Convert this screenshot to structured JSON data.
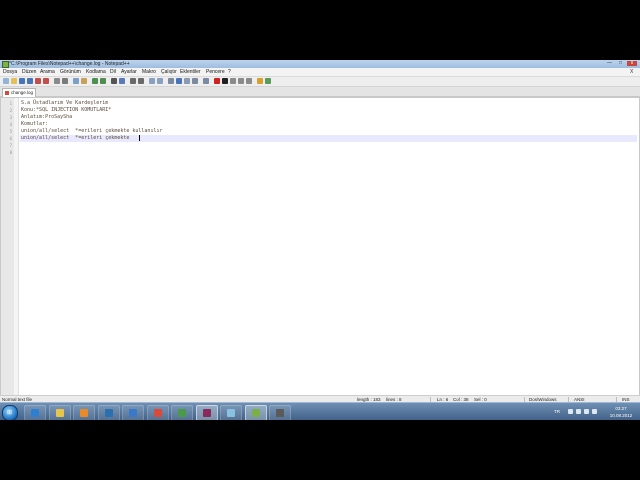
{
  "window": {
    "title": "*C:\\Program Files\\Notepad++\\change.log - Notepad++",
    "minimize_glyph": "—",
    "maximize_glyph": "□",
    "close_glyph": "x"
  },
  "menu": {
    "items": [
      "Dosya",
      "Düzen",
      "Arama",
      "Görünüm",
      "Kodlama",
      "Dil",
      "Ayarlar",
      "Makro",
      "Çalıştır",
      "Eklentiler",
      "Pencere",
      "?"
    ],
    "close_glyph": "X"
  },
  "toolbar": {
    "buttons": [
      {
        "icon": "new-file-icon",
        "color": "#8fb4d8"
      },
      {
        "icon": "open-file-icon",
        "color": "#e3c05a"
      },
      {
        "icon": "save-icon",
        "color": "#4a74b8"
      },
      {
        "icon": "save-all-icon",
        "color": "#4a74b8"
      },
      {
        "icon": "close-icon",
        "color": "#c0504d"
      },
      {
        "icon": "close-all-icon",
        "color": "#c0504d"
      },
      {
        "icon": "print-icon",
        "color": "#8a8a8a"
      },
      {
        "icon": "cut-icon",
        "color": "#7a7a7a"
      },
      {
        "icon": "copy-icon",
        "color": "#7aa0c8"
      },
      {
        "icon": "paste-icon",
        "color": "#c9a05a"
      },
      {
        "icon": "undo-icon",
        "color": "#4f8f4f"
      },
      {
        "icon": "redo-icon",
        "color": "#4f8f4f"
      },
      {
        "icon": "find-icon",
        "color": "#555555"
      },
      {
        "icon": "replace-icon",
        "color": "#5a7ab8"
      },
      {
        "icon": "zoom-in-icon",
        "color": "#6a6a6a"
      },
      {
        "icon": "zoom-out-icon",
        "color": "#6a6a6a"
      },
      {
        "icon": "sync-vertical-icon",
        "color": "#8aa0c0"
      },
      {
        "icon": "sync-horizontal-icon",
        "color": "#8aa0c0"
      },
      {
        "icon": "word-wrap-icon",
        "color": "#7a8aa0"
      },
      {
        "icon": "all-chars-icon",
        "color": "#4a74b8"
      },
      {
        "icon": "indent-guide-icon",
        "color": "#8a9ab0"
      },
      {
        "icon": "fold-icon",
        "color": "#7a8aa0"
      },
      {
        "icon": "unfold-icon",
        "color": "#7a8aa0"
      },
      {
        "icon": "record-macro-icon",
        "color": "#d02020"
      },
      {
        "icon": "stop-macro-icon",
        "color": "#202020"
      },
      {
        "icon": "play-macro-icon",
        "color": "#8a8a8a"
      },
      {
        "icon": "play-multiple-icon",
        "color": "#8a8a8a"
      },
      {
        "icon": "save-macro-icon",
        "color": "#8a8a8a"
      },
      {
        "icon": "spellcheck-icon",
        "color": "#d9a030"
      },
      {
        "icon": "plugin-icon",
        "color": "#5a9a5a"
      }
    ]
  },
  "tabs": [
    {
      "label": "change.log",
      "icon": "file-modified-icon",
      "active": true
    }
  ],
  "editor": {
    "lines": [
      "S.a Üstadlarım Ve Kardeşlerim",
      "Konu:*SQL INJECTION KOMUTLARI*",
      "Anlatım:ProSaySha",
      "Komutlar:",
      "union/all/select  *=erileri çekmekte kullanılır",
      "union/all/select  *=erileri çekmekte ",
      "",
      ""
    ],
    "current_line": 6
  },
  "status": {
    "file_type": "Normal text file",
    "length": "length : 183",
    "lines": "lines : 8",
    "ln": "Ln : 6",
    "col": "Col : 38",
    "sel": "Sel : 0",
    "eol": "Dos\\Windows",
    "encoding": "ANSI",
    "mode": "INS"
  },
  "taskbar": {
    "start_glyph": "⊞",
    "items": [
      {
        "icon": "ie-icon",
        "color": "#2f7fd0",
        "active": false
      },
      {
        "icon": "explorer-icon",
        "color": "#e8c44a",
        "active": false
      },
      {
        "icon": "media-player-icon",
        "color": "#e8892a",
        "active": false
      },
      {
        "icon": "skype-icon",
        "color": "#2a6fb0",
        "active": false
      },
      {
        "icon": "paint-icon",
        "color": "#3a78c8",
        "active": false
      },
      {
        "icon": "chrome-icon",
        "color": "#d84a3a",
        "active": false
      },
      {
        "icon": "network-icon",
        "color": "#4a9a4a",
        "active": false
      },
      {
        "icon": "winrar-icon",
        "color": "#8a2a5a",
        "active": true
      },
      {
        "icon": "sniffer-icon",
        "color": "#8ac0e0",
        "active": false
      },
      {
        "icon": "notepad-plus-icon",
        "color": "#7ab04a",
        "active": true
      },
      {
        "icon": "tool-icon",
        "color": "#5a5a5a",
        "active": false
      }
    ],
    "language": "TR",
    "time": "03:27",
    "date": "10.08.2012"
  }
}
